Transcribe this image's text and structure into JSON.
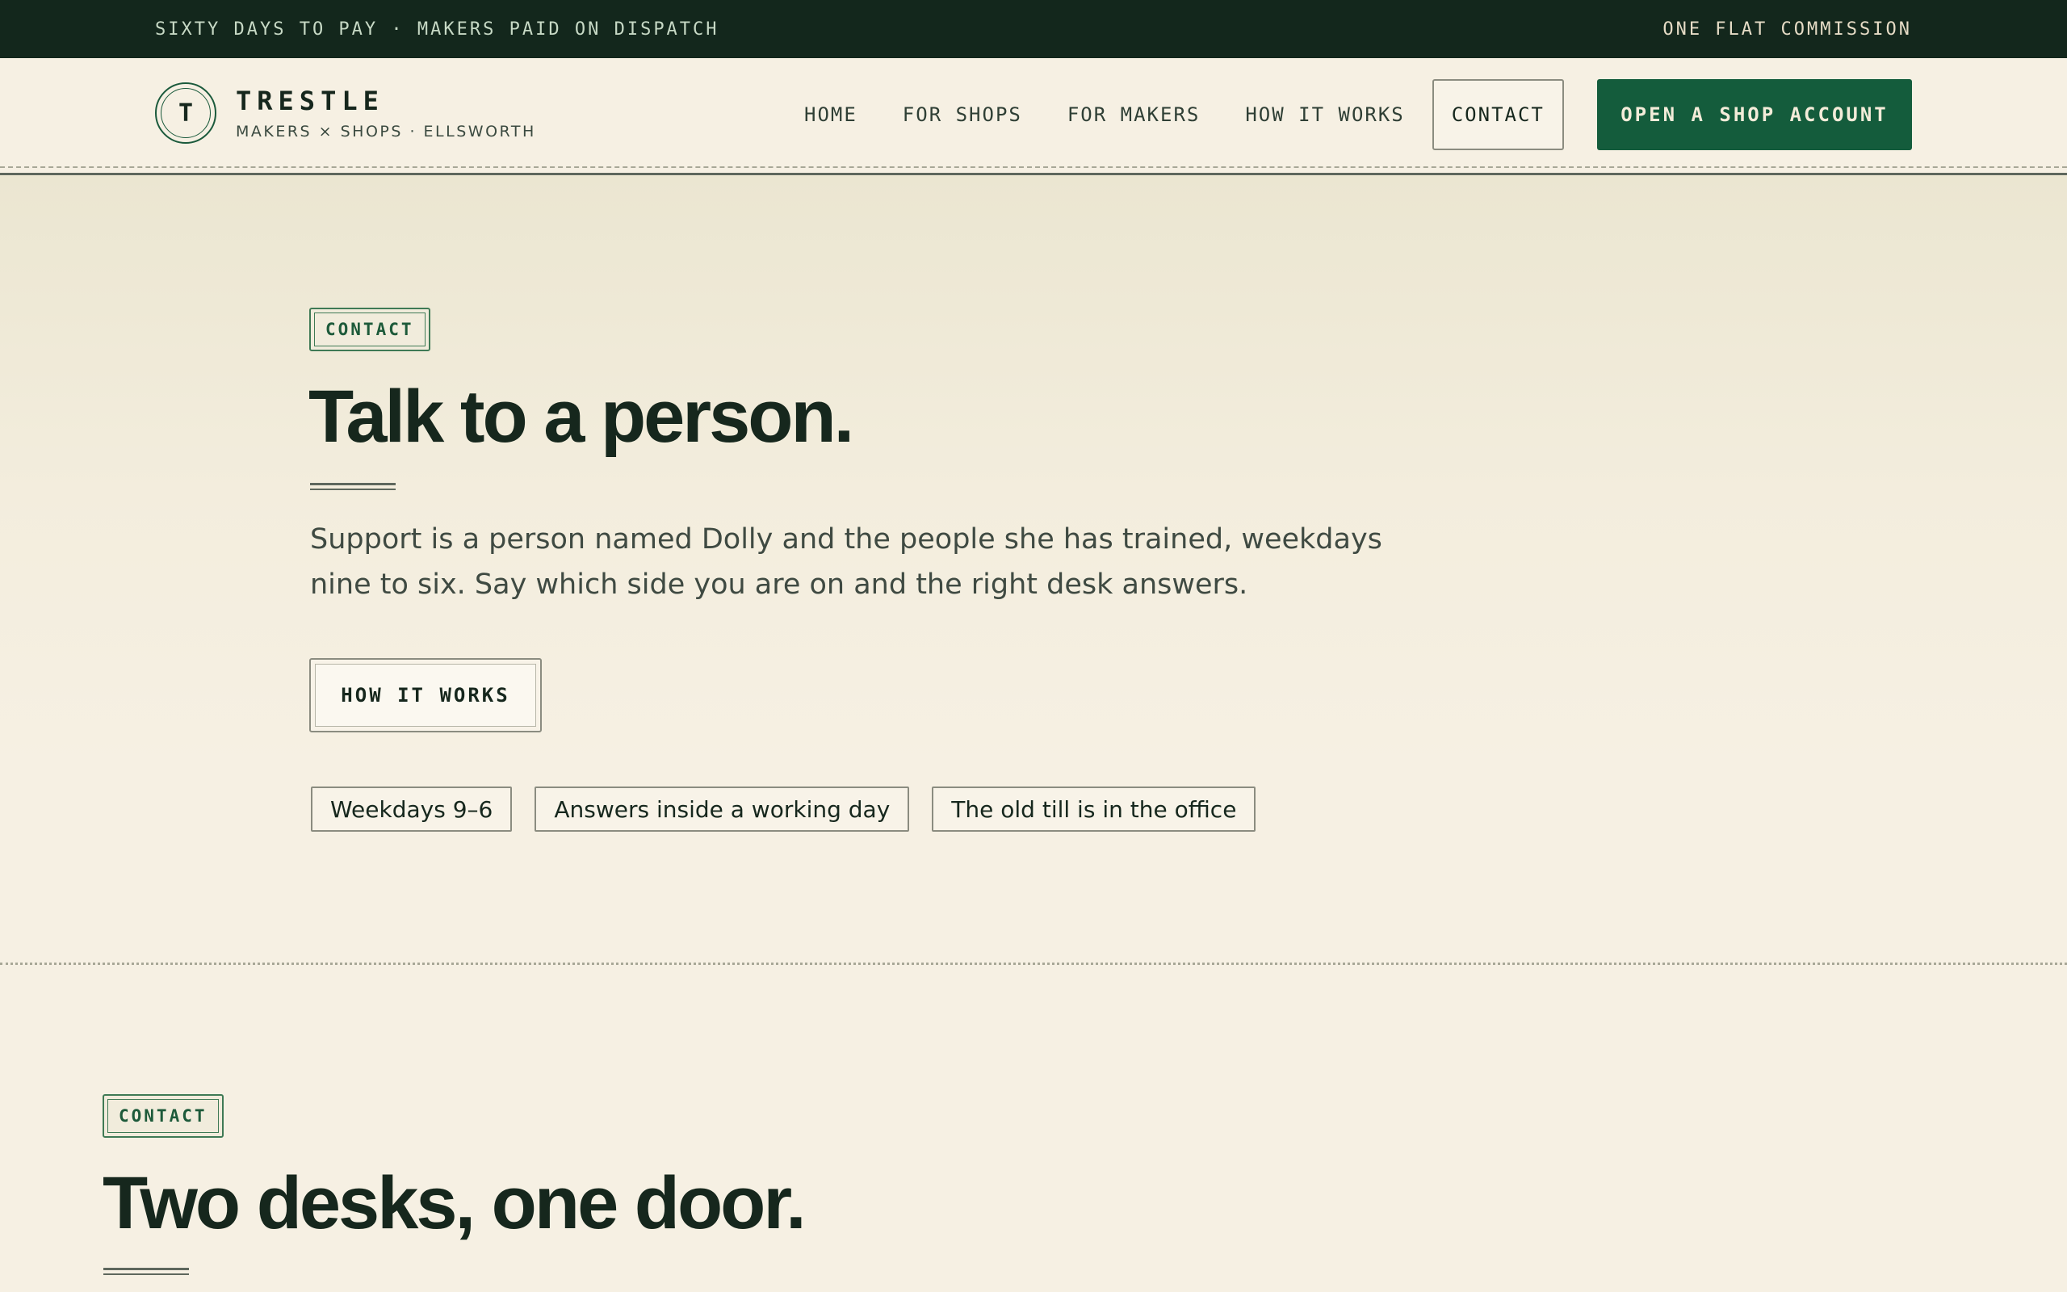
{
  "topbar": {
    "left_text": "SIXTY DAYS TO PAY · MAKERS PAID ON DISPATCH",
    "right_text": "ONE FLAT COMMISSION"
  },
  "brand": {
    "mark_letter": "T",
    "name": "TRESTLE",
    "tagline": "MAKERS × SHOPS · ELLSWORTH"
  },
  "nav": {
    "items": [
      {
        "label": "HOME"
      },
      {
        "label": "FOR SHOPS"
      },
      {
        "label": "FOR MAKERS"
      },
      {
        "label": "HOW IT WORKS"
      },
      {
        "label": "CONTACT",
        "active": true
      }
    ],
    "cta_label": "OPEN A SHOP ACCOUNT"
  },
  "hero": {
    "tag": "CONTACT",
    "title": "Talk to a person.",
    "lede": "Support is a person named Dolly and the people she has trained, weekdays nine to six. Say which side you are on and the right desk answers.",
    "button_label": "HOW IT WORKS",
    "chips": [
      "Weekdays 9–6",
      "Answers inside a working day",
      "The old till is in the office"
    ]
  },
  "section2": {
    "tag": "CONTACT",
    "title": "Two desks, one door."
  },
  "colors": {
    "background": "#f6f0e3",
    "topbar": "#13271c",
    "accent_green": "#145c3c",
    "ink": "#16271d"
  }
}
